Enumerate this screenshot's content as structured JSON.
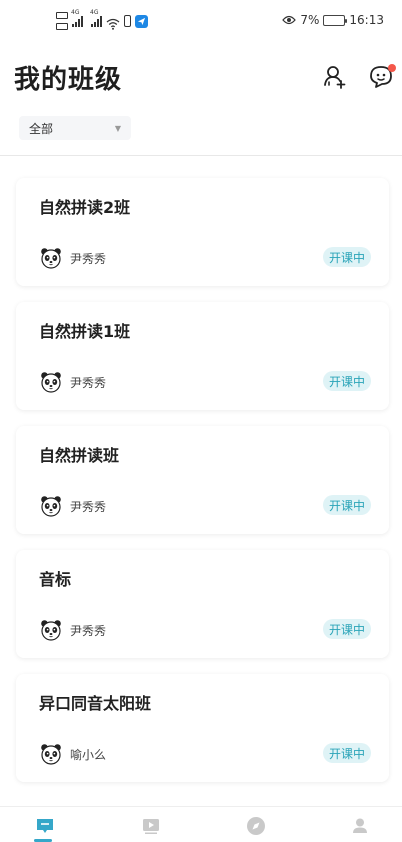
{
  "status_bar": {
    "network_left": "4G",
    "network_right": "4G",
    "battery_percent": "7%",
    "time": "16:13"
  },
  "header": {
    "title": "我的班级",
    "icons": [
      "add-friend-icon",
      "message-icon"
    ]
  },
  "filter": {
    "selected": "全部"
  },
  "classes": [
    {
      "name": "自然拼读2班",
      "teacher": "尹秀秀",
      "status": "开课中"
    },
    {
      "name": "自然拼读1班",
      "teacher": "尹秀秀",
      "status": "开课中"
    },
    {
      "name": "自然拼读班",
      "teacher": "尹秀秀",
      "status": "开课中"
    },
    {
      "name": "音标",
      "teacher": "尹秀秀",
      "status": "开课中"
    },
    {
      "name": "异口同音太阳班",
      "teacher": "喻小么",
      "status": "开课中"
    }
  ],
  "bottom_nav": {
    "items": [
      "class-icon",
      "video-icon",
      "discover-icon",
      "profile-icon"
    ],
    "active_index": 0
  },
  "colors": {
    "accent": "#35a7c9",
    "badge_bg": "#dff3f6",
    "badge_text": "#2aa4b8",
    "notification_dot": "#f4574a",
    "battery_low": "#e53935"
  }
}
